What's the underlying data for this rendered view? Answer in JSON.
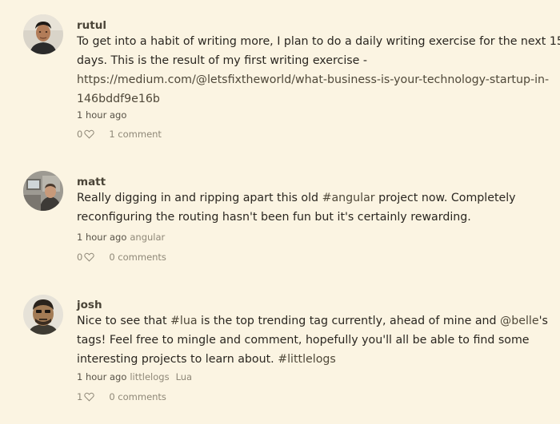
{
  "posts": [
    {
      "username": "rutul",
      "avatar_icon": "user-avatar-rutul",
      "text_lines": [
        "To get into a habit of writing more, I plan to do a daily writing exercise for the next 15",
        "days. This is the result of my first writing exercise -"
      ],
      "link_lines": [
        "https://medium.com/@letsfixtheworld/what-business-is-your-technology-startup-in-",
        "146bddf9e16b"
      ],
      "time": "1 hour ago",
      "tags": [],
      "likes": "0",
      "comments": "1 comment"
    },
    {
      "username": "matt",
      "avatar_icon": "user-avatar-matt",
      "text_line1_before": "Really digging in and ripping apart this old ",
      "text_line1_tag": "#angular",
      "text_line1_after": " project now. Completely",
      "text_line2": "reconfiguring the routing hasn't been fun but it's certainly rewarding.",
      "time": "1 hour ago",
      "tags": [
        "angular"
      ],
      "likes": "0",
      "comments": "0 comments"
    },
    {
      "username": "josh",
      "avatar_icon": "user-avatar-josh",
      "text_line1_before": "Nice to see that ",
      "text_line1_tag": "#lua",
      "text_line1_mid": " is the top trending tag currently, ahead of mine and ",
      "text_line1_mention": "@belle",
      "text_line1_after": "'s",
      "text_line2": "tags! Feel free to mingle and comment, hopefully you'll all be able to find some",
      "text_line3_before": "interesting projects to learn about. ",
      "text_line3_tag": "#littlelogs",
      "time": "1 hour ago",
      "tags": [
        "littlelogs",
        "Lua"
      ],
      "likes": "1",
      "comments": "0 comments"
    }
  ],
  "colors": {
    "background": "#fbf4e2",
    "text": "#2a2620",
    "muted": "#8f8878"
  },
  "icons": {
    "like": "heart-outline-icon"
  }
}
